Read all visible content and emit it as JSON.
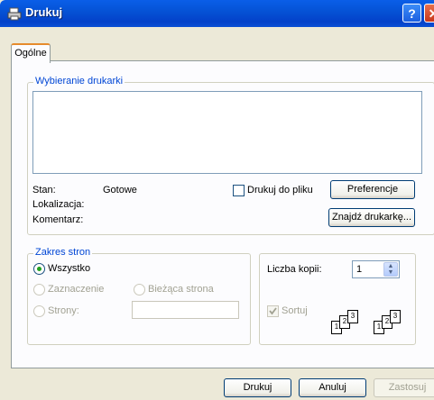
{
  "window": {
    "title": "Drukuj"
  },
  "tabs": [
    {
      "label": "Ogólne"
    }
  ],
  "printer_group": {
    "title": "Wybieranie drukarki",
    "status_label": "Stan:",
    "status_value": "Gotowe",
    "location_label": "Lokalizacja:",
    "comment_label": "Komentarz:",
    "print_to_file_label": "Drukuj do pliku",
    "print_to_file_checked": false,
    "preferences_button": "Preferencje",
    "find_printer_button": "Znajdź drukarkę..."
  },
  "page_range": {
    "title": "Zakres stron",
    "all_label": "Wszystko",
    "all_selected": true,
    "selection_label": "Zaznaczenie",
    "current_page_label": "Bieżąca strona",
    "pages_label": "Strony:",
    "pages_value": ""
  },
  "copies": {
    "count_label": "Liczba kopii:",
    "count_value": "1",
    "collate_label": "Sortuj",
    "collate_checked": true,
    "collate_icon_pages": [
      "1",
      "2",
      "3",
      "1",
      "2",
      "3"
    ]
  },
  "footer": {
    "print_button": "Drukuj",
    "cancel_button": "Anuluj",
    "apply_button": "Zastosuj"
  }
}
